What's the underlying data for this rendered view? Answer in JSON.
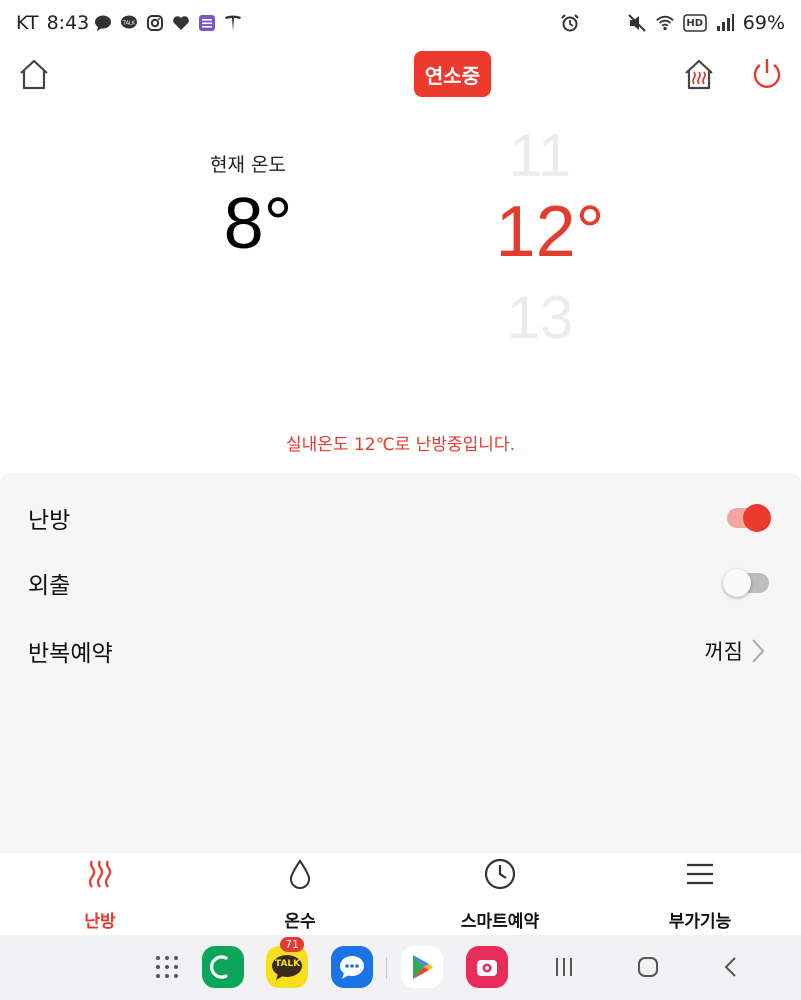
{
  "status_bar": {
    "carrier": "KT",
    "time": "8:43",
    "battery": "69%",
    "hd_label": "HD",
    "notif_icons": [
      "chat-bubble-icon",
      "talk-icon",
      "instagram-icon",
      "heart-icon",
      "list-app-icon",
      "tesla-icon"
    ],
    "right_icons": [
      "alarm-icon",
      "mute-icon",
      "wifi-icon",
      "hd-icon",
      "signal-icon"
    ]
  },
  "header": {
    "badge": "연소중"
  },
  "temperature": {
    "current_label": "현재 온도",
    "current_value": "8°",
    "picker_prev": "11",
    "picker_selected": "12°",
    "picker_next": "13",
    "status_message": "실내온도 12℃로 난방중입니다."
  },
  "settings": {
    "heating_label": "난방",
    "heating_on": true,
    "away_label": "외출",
    "away_on": false,
    "schedule_label": "반복예약",
    "schedule_value": "꺼짐"
  },
  "tabs": [
    {
      "label": "난방",
      "icon": "heat-waves-icon",
      "active": true
    },
    {
      "label": "온수",
      "icon": "water-drop-icon",
      "active": false
    },
    {
      "label": "스마트예약",
      "icon": "clock-icon",
      "active": false
    },
    {
      "label": "부가기능",
      "icon": "menu-icon",
      "active": false
    }
  ],
  "navbar": {
    "talk_badge": "71",
    "talk_label": "TALK",
    "apps": [
      "app-drawer-icon",
      "phone-app-icon",
      "kakaotalk-app-icon",
      "messages-app-icon",
      "play-store-icon",
      "camera-app-icon"
    ]
  },
  "colors": {
    "accent": "#ec3b2e",
    "panel_bg": "#f6f6f6"
  }
}
